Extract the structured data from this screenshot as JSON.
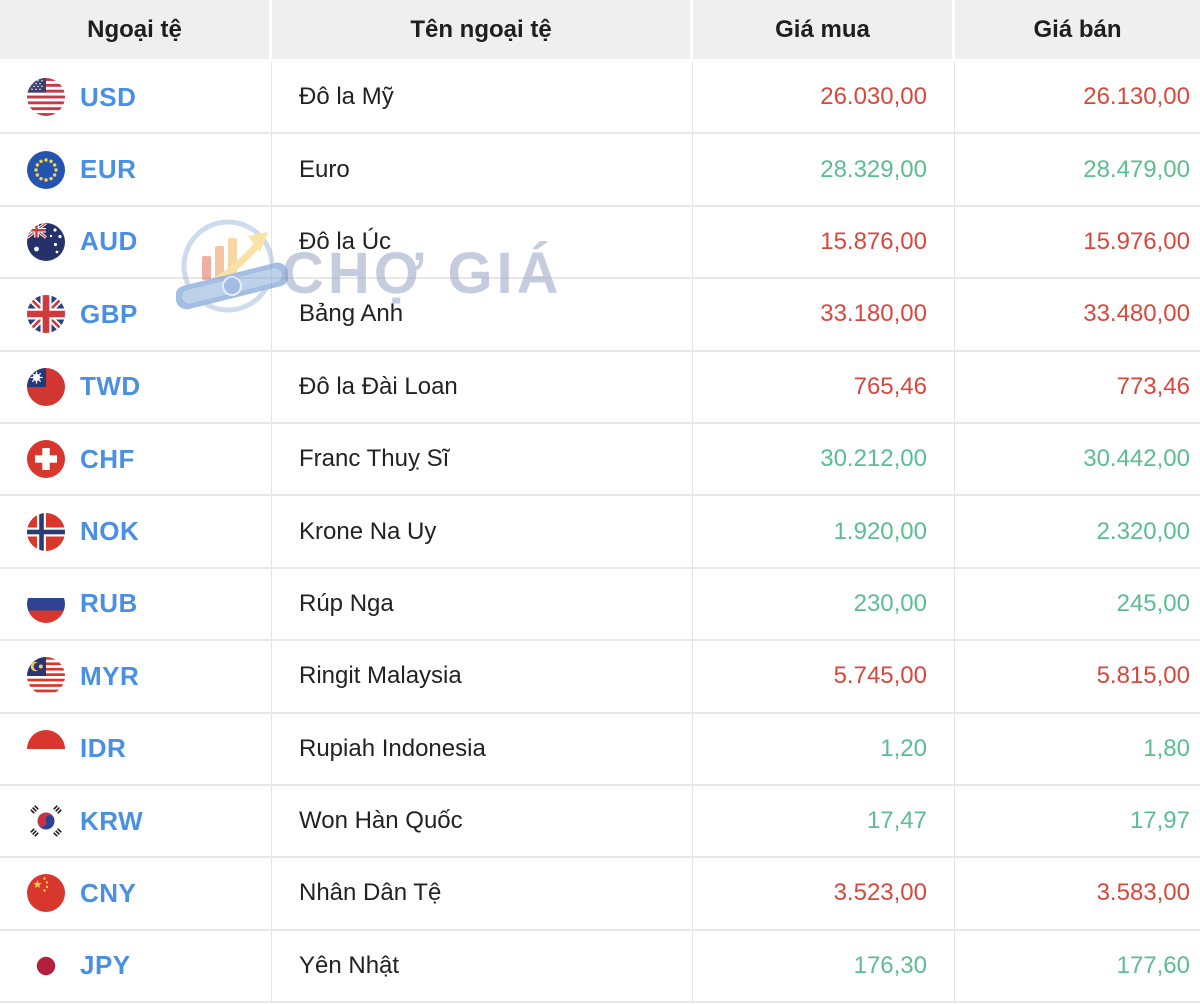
{
  "header": {
    "columns": [
      {
        "label": "Ngoại tệ"
      },
      {
        "label": "Tên ngoại tệ"
      },
      {
        "label": "Giá mua"
      },
      {
        "label": "Giá bán"
      }
    ]
  },
  "watermark": {
    "text": "CHỢ GIÁ",
    "logo": "cho-gia-logo"
  },
  "colors": {
    "price_up_green": "#5bbd90",
    "price_down_red": "#d9473c",
    "currency_code_blue": "#4a90e2",
    "header_bg": "#efefef"
  },
  "rows": [
    {
      "flag": "us-flag",
      "code": "USD",
      "name": "Đô la Mỹ",
      "buy": "26.030,00",
      "sell": "26.130,00",
      "trend": "down"
    },
    {
      "flag": "eu-flag",
      "code": "EUR",
      "name": "Euro",
      "buy": "28.329,00",
      "sell": "28.479,00",
      "trend": "up"
    },
    {
      "flag": "au-flag",
      "code": "AUD",
      "name": "Đô la Úc",
      "buy": "15.876,00",
      "sell": "15.976,00",
      "trend": "down"
    },
    {
      "flag": "gb-flag",
      "code": "GBP",
      "name": "Bảng Anh",
      "buy": "33.180,00",
      "sell": "33.480,00",
      "trend": "down"
    },
    {
      "flag": "tw-flag",
      "code": "TWD",
      "name": "Đô la Đài Loan",
      "buy": "765,46",
      "sell": "773,46",
      "trend": "down"
    },
    {
      "flag": "ch-flag",
      "code": "CHF",
      "name": "Franc Thuỵ Sĩ",
      "buy": "30.212,00",
      "sell": "30.442,00",
      "trend": "up"
    },
    {
      "flag": "no-flag",
      "code": "NOK",
      "name": "Krone Na Uy",
      "buy": "1.920,00",
      "sell": "2.320,00",
      "trend": "up"
    },
    {
      "flag": "ru-flag",
      "code": "RUB",
      "name": "Rúp Nga",
      "buy": "230,00",
      "sell": "245,00",
      "trend": "up"
    },
    {
      "flag": "my-flag",
      "code": "MYR",
      "name": "Ringit Malaysia",
      "buy": "5.745,00",
      "sell": "5.815,00",
      "trend": "down"
    },
    {
      "flag": "id-flag",
      "code": "IDR",
      "name": "Rupiah Indonesia",
      "buy": "1,20",
      "sell": "1,80",
      "trend": "up"
    },
    {
      "flag": "kr-flag",
      "code": "KRW",
      "name": "Won Hàn Quốc",
      "buy": "17,47",
      "sell": "17,97",
      "trend": "up"
    },
    {
      "flag": "cn-flag",
      "code": "CNY",
      "name": "Nhân Dân Tệ",
      "buy": "3.523,00",
      "sell": "3.583,00",
      "trend": "down"
    },
    {
      "flag": "jp-flag",
      "code": "JPY",
      "name": "Yên Nhật",
      "buy": "176,30",
      "sell": "177,60",
      "trend": "up"
    }
  ]
}
